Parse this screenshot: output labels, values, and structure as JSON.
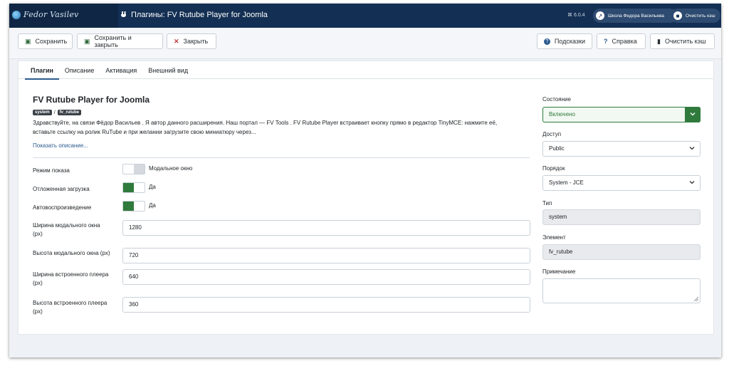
{
  "header": {
    "logo_text": "Fedor Vasilev",
    "title": "Плагины: FV Rutube Player for Joomla",
    "version": "6.0.4",
    "site_button": "Школа Федора Васильева",
    "cache_button": "Очистить кэш"
  },
  "toolbar": {
    "save": "Сохранить",
    "save_close": "Сохранить и закрыть",
    "close": "Закрыть",
    "hints": "Подсказки",
    "help": "Справка",
    "clear_cache": "Очистить кэш"
  },
  "tabs": [
    "Плагин",
    "Описание",
    "Активация",
    "Внешний вид"
  ],
  "plugin": {
    "title": "FV Rutube Player for Joomla",
    "group": "system",
    "slash": "/",
    "element": "fv_rutube",
    "description_1": "Здравствуйте, на связи Фёдор Васильев . Я автор данного расширения. Наш портал — FV Tools . FV Rutube Player встраивает кнопку прямо в редактор TinyMCE: нажмите её,",
    "description_2": "вставьте ссылку на ролик RuTube и при желании загрузите свою миниатюру через...",
    "show_more": "Показать описание..."
  },
  "fields": {
    "display_mode": {
      "label": "Режим показа",
      "value": "Модальное окно",
      "on": false
    },
    "lazy_load": {
      "label": "Отложенная загрузка",
      "value": "Да",
      "on": true
    },
    "autoplay": {
      "label": "Автовоспроизведение",
      "value": "Да",
      "on": true
    },
    "modal_width": {
      "label_1": "Ширина модального окна",
      "label_2": "(px)",
      "value": "1280"
    },
    "modal_height": {
      "label": "Высота модального окна (px)",
      "value": "720"
    },
    "embed_width": {
      "label_1": "Ширина встроенного плеера",
      "label_2": "(px)",
      "value": "640"
    },
    "embed_height": {
      "label_1": "Высота встроенного плеера",
      "label_2": "(px)",
      "value": "360"
    }
  },
  "sidebar": {
    "status_label": "Состояние",
    "status_value": "Включено",
    "access_label": "Доступ",
    "access_value": "Public",
    "order_label": "Порядок",
    "order_value": "System - JCE",
    "type_label": "Тип",
    "type_value": "system",
    "element_label": "Элемент",
    "element_value": "fv_rutube",
    "note_label": "Примечание"
  },
  "colors": {
    "header_bg": "#132f53",
    "accent_green": "#2f7a3c",
    "link_blue": "#2c5b8f"
  }
}
